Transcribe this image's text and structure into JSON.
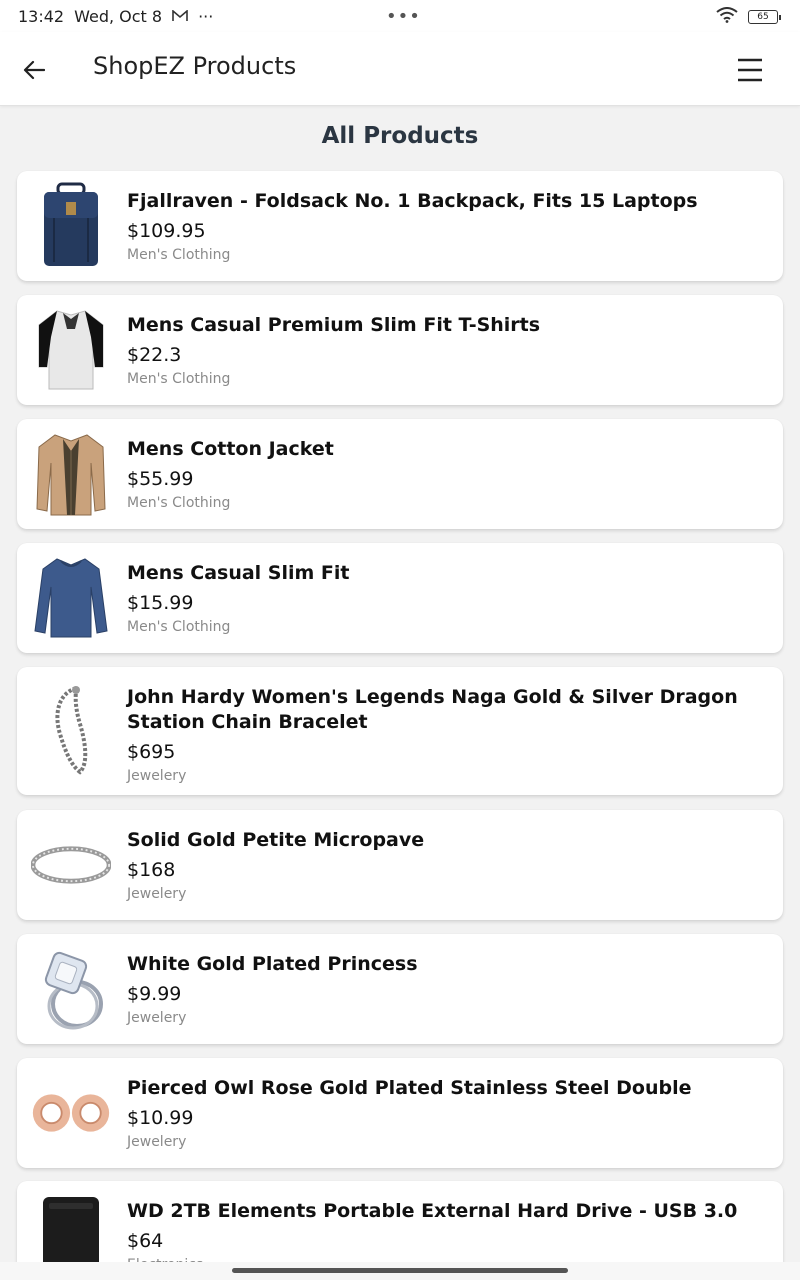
{
  "status_bar": {
    "time": "13:42",
    "date": "Wed, Oct 8",
    "more": "···",
    "center_dots": "•••",
    "battery": "65"
  },
  "app_bar": {
    "title": "ShopEZ Products"
  },
  "page": {
    "heading": "All Products"
  },
  "products": [
    {
      "title": "Fjallraven - Foldsack No. 1 Backpack, Fits 15 Laptops",
      "price": "$109.95",
      "category": "Men's Clothing",
      "icon": "backpack-icon"
    },
    {
      "title": "Mens Casual Premium Slim Fit T-Shirts",
      "price": "$22.3",
      "category": "Men's Clothing",
      "icon": "tshirt-icon"
    },
    {
      "title": "Mens Cotton Jacket",
      "price": "$55.99",
      "category": "Men's Clothing",
      "icon": "jacket-icon"
    },
    {
      "title": "Mens Casual Slim Fit",
      "price": "$15.99",
      "category": "Men's Clothing",
      "icon": "longsleeve-shirt-icon"
    },
    {
      "title": "John Hardy Women's Legends Naga Gold & Silver Dragon Station Chain Bracelet",
      "price": "$695",
      "category": "Jewelery",
      "icon": "chain-bracelet-icon"
    },
    {
      "title": "Solid Gold Petite Micropave",
      "price": "$168",
      "category": "Jewelery",
      "icon": "bangle-icon"
    },
    {
      "title": "White Gold Plated Princess",
      "price": "$9.99",
      "category": "Jewelery",
      "icon": "ring-icon"
    },
    {
      "title": "Pierced Owl Rose Gold Plated Stainless Steel Double",
      "price": "$10.99",
      "category": "Jewelery",
      "icon": "ear-plugs-icon"
    },
    {
      "title": "WD 2TB Elements Portable External Hard Drive - USB 3.0",
      "price": "$64",
      "category": "Electronics",
      "icon": "hard-drive-icon"
    }
  ]
}
